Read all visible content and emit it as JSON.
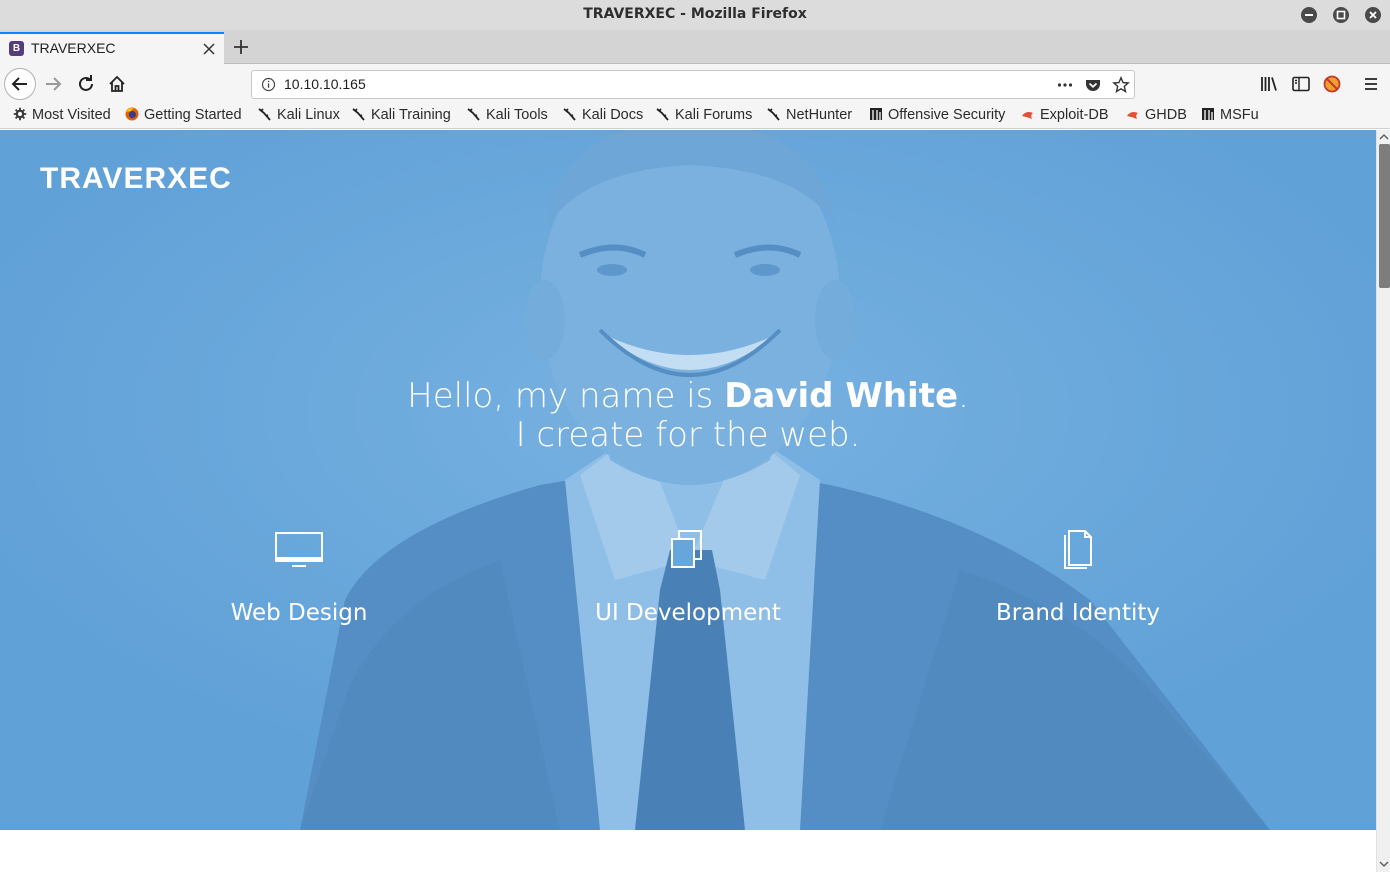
{
  "window": {
    "title": "TRAVERXEC - Mozilla Firefox"
  },
  "tab": {
    "label": "TRAVERXEC",
    "favicon_letter": "B"
  },
  "urlbar": {
    "url": "10.10.10.165"
  },
  "bookmarks": [
    {
      "label": "Most Visited",
      "icon": "gear-icon"
    },
    {
      "label": "Getting Started",
      "icon": "firefox-icon"
    },
    {
      "label": "Kali Linux",
      "icon": "kali-icon"
    },
    {
      "label": "Kali Training",
      "icon": "kali-icon"
    },
    {
      "label": "Kali Tools",
      "icon": "kali-icon"
    },
    {
      "label": "Kali Docs",
      "icon": "kali-icon"
    },
    {
      "label": "Kali Forums",
      "icon": "kali-icon"
    },
    {
      "label": "NetHunter",
      "icon": "kali-icon"
    },
    {
      "label": "Offensive Security",
      "icon": "offsec-icon"
    },
    {
      "label": "Exploit-DB",
      "icon": "exploitdb-icon"
    },
    {
      "label": "GHDB",
      "icon": "exploitdb-icon"
    },
    {
      "label": "MSFu",
      "icon": "offsec-icon"
    }
  ],
  "page": {
    "brand": "TRAVERXEC",
    "headline": {
      "prefix": "Hello, my name is ",
      "name": "David White",
      "suffix": ".",
      "line2": "I create for the web."
    },
    "services": [
      {
        "label": "Web Design",
        "icon": "monitor-icon"
      },
      {
        "label": "UI Development",
        "icon": "layers-icon"
      },
      {
        "label": "Brand Identity",
        "icon": "document-icon"
      }
    ]
  },
  "colors": {
    "hero_blue": "#66a6da",
    "tab_accent": "#0a84ff",
    "favicon_bg": "#563d7c"
  }
}
